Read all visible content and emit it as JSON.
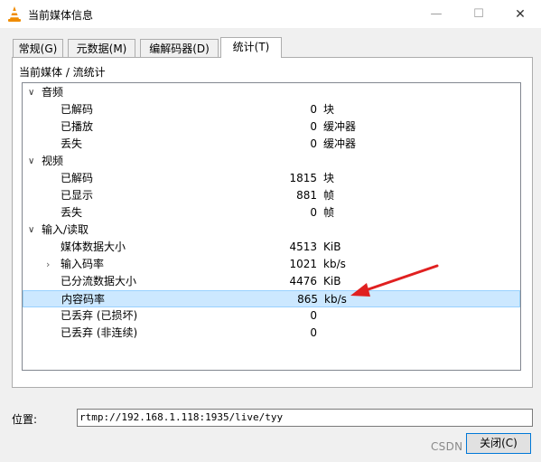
{
  "window": {
    "title": "当前媒体信息",
    "min": "—",
    "max": "☐",
    "close": "✕"
  },
  "tabs": [
    {
      "label": "常规(G)"
    },
    {
      "label": "元数据(M)"
    },
    {
      "label": "编解码器(D)"
    },
    {
      "label": "统计(T)"
    }
  ],
  "stats": {
    "section_title": "当前媒体 / 流统计",
    "audio": {
      "label": "音频",
      "rows": [
        {
          "label": "已解码",
          "value": "0",
          "unit": "块"
        },
        {
          "label": "已播放",
          "value": "0",
          "unit": "缓冲器"
        },
        {
          "label": "丢失",
          "value": "0",
          "unit": "缓冲器"
        }
      ]
    },
    "video": {
      "label": "视频",
      "rows": [
        {
          "label": "已解码",
          "value": "1815",
          "unit": "块"
        },
        {
          "label": "已显示",
          "value": "881",
          "unit": "帧"
        },
        {
          "label": "丢失",
          "value": "0",
          "unit": "帧"
        }
      ]
    },
    "input": {
      "label": "输入/读取",
      "rows": [
        {
          "label": "媒体数据大小",
          "value": "4513",
          "unit": "KiB"
        },
        {
          "label": "输入码率",
          "value": "1021",
          "unit": "kb/s"
        },
        {
          "label": "已分流数据大小",
          "value": "4476",
          "unit": "KiB"
        },
        {
          "label": "内容码率",
          "value": "865",
          "unit": "kb/s"
        },
        {
          "label": "已丢弃 (已损坏)",
          "value": "0",
          "unit": ""
        },
        {
          "label": "已丢弃 (非连续)",
          "value": "0",
          "unit": ""
        }
      ]
    }
  },
  "location": {
    "label": "位置:",
    "value": "rtmp://192.168.1.118:1935/live/tyy"
  },
  "close_button": {
    "label": "关闭(C)"
  },
  "watermark": "CSDN @来顺妈酱",
  "colors": {
    "selection": "#cce8ff",
    "arrow": "#e02020",
    "focus_border": "#0078d7"
  }
}
